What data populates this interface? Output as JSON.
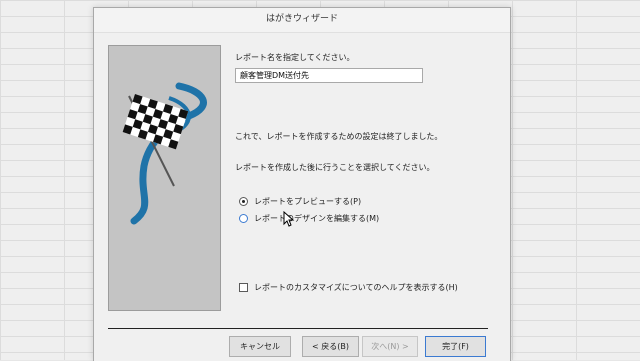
{
  "window": {
    "title": "はがきウィザード"
  },
  "prompt_name": "レポート名を指定してください。",
  "report_name_value": "顧客管理DM送付先",
  "info_text": "これで、レポートを作成するための設定は終了しました。",
  "next_action_prompt": "レポートを作成した後に行うことを選択してください。",
  "options": [
    {
      "label": "レポートをプレビューする(P)",
      "checked": true
    },
    {
      "label": "レポートのデザインを編集する(M)",
      "checked": false
    }
  ],
  "help_checkbox": {
    "label": "レポートのカスタマイズについてのヘルプを表示する(H)",
    "checked": false
  },
  "buttons": {
    "cancel": "キャンセル",
    "back": "< 戻る(B)",
    "next": "次へ(N) >",
    "finish": "完了(F)"
  },
  "colors": {
    "accent": "#3b7ad1",
    "flag_swoosh": "#1f73a8"
  }
}
